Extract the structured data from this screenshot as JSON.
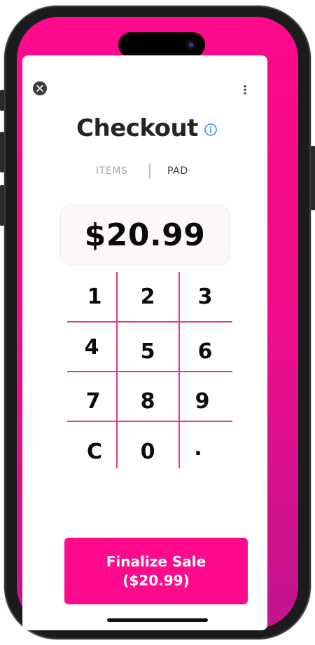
{
  "header": {
    "title": "Checkout"
  },
  "tabs": [
    {
      "label": "ITEMS",
      "active": false
    },
    {
      "label": "PAD",
      "active": true
    }
  ],
  "amount_display": "$20.99",
  "keypad": [
    "1",
    "2",
    "3",
    "4",
    "5",
    "6",
    "7",
    "8",
    "9",
    "C",
    "0",
    "."
  ],
  "finalize": {
    "line1": "Finalize Sale",
    "line2": "($20.99)"
  },
  "colors": {
    "accent": "#ff0a8c",
    "grid": "#e43594",
    "text": "#0b0b0b"
  },
  "icons": {
    "close": "close-icon",
    "menu": "more-vertical-icon",
    "info": "info-icon"
  }
}
